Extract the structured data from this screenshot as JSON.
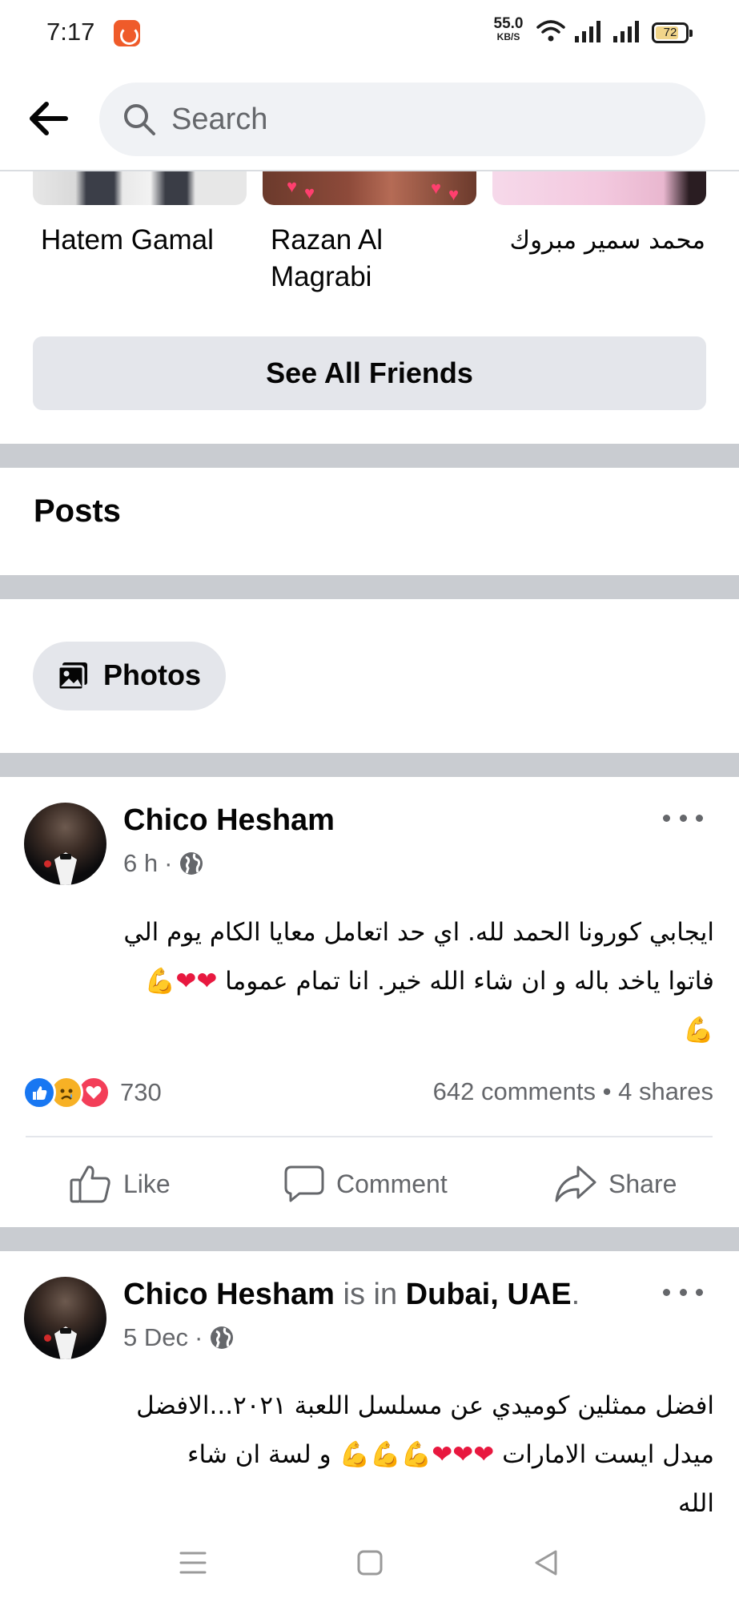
{
  "status_bar": {
    "time": "7:17",
    "net_speed_value": "55.0",
    "net_speed_unit": "KB/S",
    "battery": "72"
  },
  "header": {
    "search_placeholder": "Search"
  },
  "friends": {
    "names": [
      "Hatem Gamal",
      "Razan Al Magrabi",
      "محمد سمير مبروك"
    ],
    "see_all_label": "See All Friends"
  },
  "posts_section": {
    "title": "Posts",
    "photos_chip_label": "Photos"
  },
  "posts": [
    {
      "author": "Chico Hesham",
      "time": "6 h",
      "dot": "·",
      "text_lines": [
        "ايجابي كورونا الحمد لله. اي حد اتعامل معايا الكام يوم الي",
        "فاتوا ياخد باله و ان شاء الله خير. انا تمام عموما",
        ""
      ],
      "line2_emojis": "💪❤❤",
      "line3_emojis": "💪",
      "reaction_count": "730",
      "comments": "642 comments",
      "stats_sep": "•",
      "shares": "4 shares",
      "actions": [
        "Like",
        "Comment",
        "Share"
      ]
    },
    {
      "author": "Chico Hesham",
      "is_in": "is in",
      "place": "Dubai, UAE",
      "place_end": ".",
      "time": "5 Dec",
      "dot": "·",
      "text_lines": [
        "افضل ممثلين كوميدي عن مسلسل اللعبة ٢٠٢١...الافضل",
        "ميدل ايست الامارات",
        "الله"
      ],
      "line2_emojis": "💪💪💪❤❤❤",
      "line2_tail": "و لسة ان شاء"
    }
  ],
  "colors": {
    "like_blue": "#1877f2",
    "love_red": "#f33e58",
    "sad_yellow": "#f7b125",
    "divider_gray": "#c9ccd1",
    "secondary_text": "#65676b"
  }
}
